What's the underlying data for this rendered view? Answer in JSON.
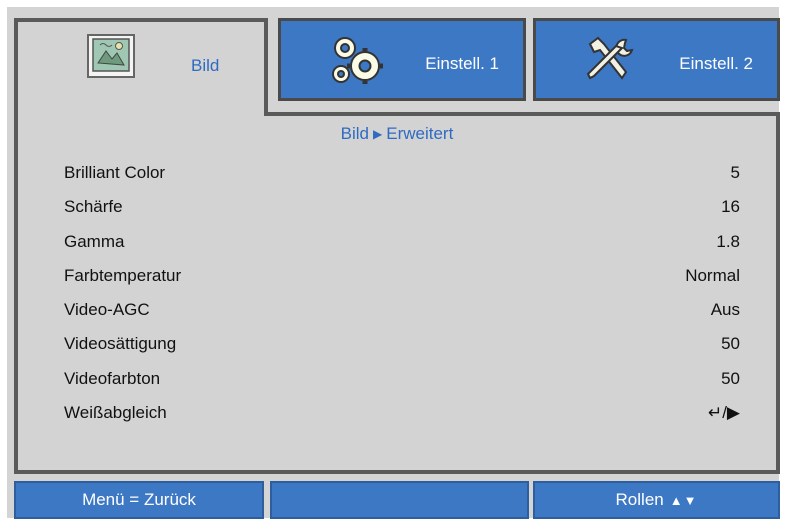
{
  "tabs": [
    {
      "label": "Bild",
      "icon": "picture-icon",
      "active": true
    },
    {
      "label": "Einstell. 1",
      "icon": "gears-icon",
      "active": false
    },
    {
      "label": "Einstell. 2",
      "icon": "tools-icon",
      "active": false
    }
  ],
  "breadcrumb": {
    "parent": "Bild",
    "separator": "▶",
    "current": "Erweitert"
  },
  "rows": [
    {
      "label": "Brilliant Color",
      "value": "5"
    },
    {
      "label": "Schärfe",
      "value": "16"
    },
    {
      "label": "Gamma",
      "value": "1.8"
    },
    {
      "label": "Farbtemperatur",
      "value": "Normal"
    },
    {
      "label": "Video-AGC",
      "value": "Aus"
    },
    {
      "label": "Videosättigung",
      "value": "50"
    },
    {
      "label": "Videofarbton",
      "value": "50"
    },
    {
      "label": "Weißabgleich",
      "value": "↵/▶"
    }
  ],
  "bottom": {
    "left": "Menü = Zurück",
    "middle": "",
    "right": "Rollen",
    "right_arrows": "▲▼"
  },
  "colors": {
    "accent": "#3d78c5",
    "highlight_text": "#2f6bc2",
    "panel": "#d3d3d3",
    "border": "#5a5a5a"
  }
}
